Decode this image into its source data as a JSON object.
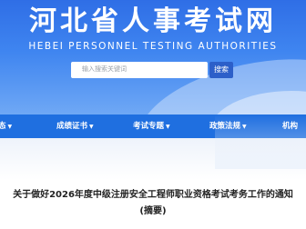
{
  "header": {
    "title": "河北省人事考试网",
    "subtitle": "HEBEI PERSONNEL TESTING AUTHORITIES"
  },
  "search": {
    "placeholder": "输入搜索关键词",
    "button_label": "搜索"
  },
  "nav": {
    "items": [
      {
        "label": "态"
      },
      {
        "label": "成绩证书"
      },
      {
        "label": "考试专题"
      },
      {
        "label": "政策法规"
      },
      {
        "label": "机构"
      }
    ]
  },
  "article": {
    "title": "关于做好2026年度中级注册安全工程师职业资格考试考务工作的通知",
    "subtitle": "(摘要)"
  }
}
